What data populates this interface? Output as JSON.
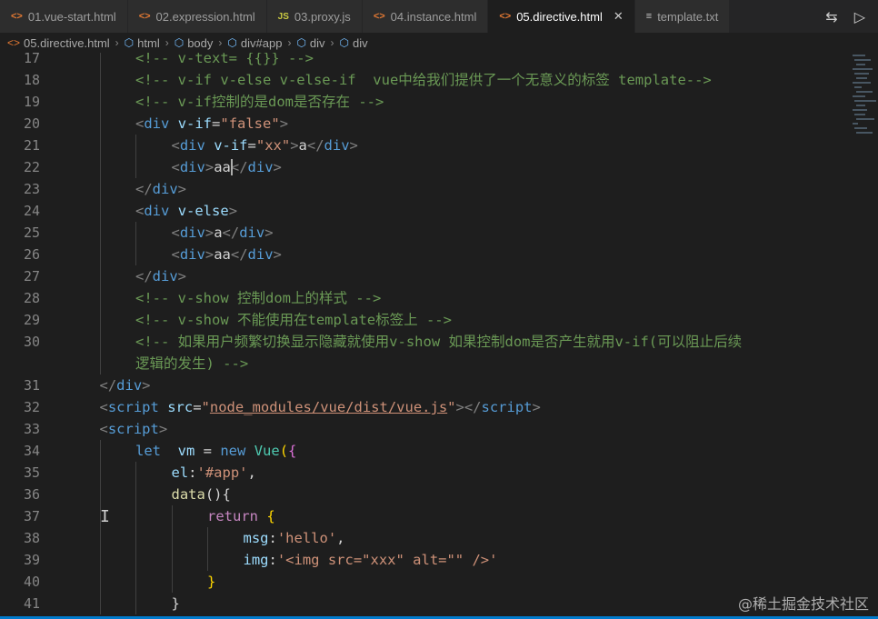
{
  "tabs": [
    {
      "icon": "<>",
      "icon_type": "html",
      "label": "01.vue-start.html",
      "active": false
    },
    {
      "icon": "<>",
      "icon_type": "html",
      "label": "02.expression.html",
      "active": false
    },
    {
      "icon": "JS",
      "icon_type": "js",
      "label": "03.proxy.js",
      "active": false
    },
    {
      "icon": "<>",
      "icon_type": "html",
      "label": "04.instance.html",
      "active": false
    },
    {
      "icon": "<>",
      "icon_type": "html",
      "label": "05.directive.html",
      "active": true
    },
    {
      "icon": "≡",
      "icon_type": "txt",
      "label": "template.txt",
      "active": false
    }
  ],
  "breadcrumb": [
    "05.directive.html",
    "html",
    "body",
    "div#app",
    "div",
    "div"
  ],
  "lines": [
    {
      "n": "17",
      "indent": 2,
      "tokens": [
        [
          "c-com",
          "<!-- v-text= {{}} -->"
        ]
      ],
      "partial": true
    },
    {
      "n": "18",
      "indent": 2,
      "tokens": [
        [
          "c-com",
          "<!-- v-if v-else v-else-if  vue中给我们提供了一个无意义的标签 template-->"
        ]
      ]
    },
    {
      "n": "19",
      "indent": 2,
      "tokens": [
        [
          "c-com",
          "<!-- v-if控制的是dom是否存在 -->"
        ]
      ]
    },
    {
      "n": "20",
      "indent": 2,
      "tokens": [
        [
          "c-punc",
          "<"
        ],
        [
          "c-tag",
          "div"
        ],
        [
          "c-text",
          " "
        ],
        [
          "c-attr",
          "v-if"
        ],
        [
          "c-text",
          "="
        ],
        [
          "c-str",
          "\"false\""
        ],
        [
          "c-punc",
          ">"
        ]
      ]
    },
    {
      "n": "21",
      "indent": 3,
      "tokens": [
        [
          "c-punc",
          "<"
        ],
        [
          "c-tag",
          "div"
        ],
        [
          "c-text",
          " "
        ],
        [
          "c-attr",
          "v-if"
        ],
        [
          "c-text",
          "="
        ],
        [
          "c-str",
          "\"xx\""
        ],
        [
          "c-punc",
          ">"
        ],
        [
          "c-text",
          "a"
        ],
        [
          "c-punc",
          "</"
        ],
        [
          "c-tag",
          "div"
        ],
        [
          "c-punc",
          ">"
        ]
      ]
    },
    {
      "n": "22",
      "indent": 3,
      "tokens": [
        [
          "c-punc",
          "<"
        ],
        [
          "c-tag",
          "div"
        ],
        [
          "c-punc",
          ">"
        ],
        [
          "c-text",
          "aa"
        ],
        [
          "c-punc",
          "</"
        ],
        [
          "c-tag",
          "div"
        ],
        [
          "c-punc",
          ">"
        ]
      ]
    },
    {
      "n": "23",
      "indent": 2,
      "tokens": [
        [
          "c-punc",
          "</"
        ],
        [
          "c-tag",
          "div"
        ],
        [
          "c-punc",
          ">"
        ]
      ]
    },
    {
      "n": "24",
      "indent": 2,
      "tokens": [
        [
          "c-punc",
          "<"
        ],
        [
          "c-tag",
          "div"
        ],
        [
          "c-text",
          " "
        ],
        [
          "c-attr",
          "v-else"
        ],
        [
          "c-punc",
          ">"
        ]
      ]
    },
    {
      "n": "25",
      "indent": 3,
      "tokens": [
        [
          "c-punc",
          "<"
        ],
        [
          "c-tag",
          "div"
        ],
        [
          "c-punc",
          ">"
        ],
        [
          "c-text",
          "a"
        ],
        [
          "c-punc",
          "</"
        ],
        [
          "c-tag",
          "div"
        ],
        [
          "c-punc",
          ">"
        ]
      ]
    },
    {
      "n": "26",
      "indent": 3,
      "tokens": [
        [
          "c-punc",
          "<"
        ],
        [
          "c-tag",
          "div"
        ],
        [
          "c-punc",
          ">"
        ],
        [
          "c-text",
          "aa"
        ],
        [
          "c-punc",
          "</"
        ],
        [
          "c-tag",
          "div"
        ],
        [
          "c-punc",
          ">"
        ]
      ]
    },
    {
      "n": "27",
      "indent": 2,
      "tokens": [
        [
          "c-punc",
          "</"
        ],
        [
          "c-tag",
          "div"
        ],
        [
          "c-punc",
          ">"
        ]
      ]
    },
    {
      "n": "28",
      "indent": 2,
      "tokens": [
        [
          "c-com",
          "<!-- v-show 控制dom上的样式 -->"
        ]
      ]
    },
    {
      "n": "29",
      "indent": 2,
      "tokens": [
        [
          "c-com",
          "<!-- v-show 不能使用在template标签上 -->"
        ]
      ]
    },
    {
      "n": "30",
      "indent": 2,
      "tokens": [
        [
          "c-com",
          "<!-- 如果用户频繁切换显示隐藏就使用v-show 如果控制dom是否产生就用v-if(可以阻止后续"
        ]
      ]
    },
    {
      "n": "",
      "indent": 2,
      "tokens": [
        [
          "c-com",
          "逻辑的发生) -->"
        ]
      ]
    },
    {
      "n": "31",
      "indent": 1,
      "tokens": [
        [
          "c-punc",
          "</"
        ],
        [
          "c-tag",
          "div"
        ],
        [
          "c-punc",
          ">"
        ]
      ]
    },
    {
      "n": "32",
      "indent": 1,
      "tokens": [
        [
          "c-punc",
          "<"
        ],
        [
          "c-tag",
          "script"
        ],
        [
          "c-text",
          " "
        ],
        [
          "c-attr",
          "src"
        ],
        [
          "c-text",
          "="
        ],
        [
          "c-str",
          "\""
        ],
        [
          "c-link",
          "node_modules/vue/dist/vue.js"
        ],
        [
          "c-str",
          "\""
        ],
        [
          "c-punc",
          "></"
        ],
        [
          "c-tag",
          "script"
        ],
        [
          "c-punc",
          ">"
        ]
      ]
    },
    {
      "n": "33",
      "indent": 1,
      "tokens": [
        [
          "c-punc",
          "<"
        ],
        [
          "c-tag",
          "script"
        ],
        [
          "c-punc",
          ">"
        ]
      ]
    },
    {
      "n": "34",
      "indent": 2,
      "tokens": [
        [
          "c-kw",
          "let"
        ],
        [
          "c-text",
          "  "
        ],
        [
          "c-var",
          "vm"
        ],
        [
          "c-text",
          " = "
        ],
        [
          "c-kw",
          "new"
        ],
        [
          "c-text",
          " "
        ],
        [
          "c-cls",
          "Vue"
        ],
        [
          "c-brace",
          "("
        ],
        [
          "c-brace2",
          "{"
        ]
      ]
    },
    {
      "n": "35",
      "indent": 3,
      "tokens": [
        [
          "c-var",
          "el"
        ],
        [
          "c-text",
          ":"
        ],
        [
          "c-str",
          "'#app'"
        ],
        [
          "c-text",
          ","
        ]
      ]
    },
    {
      "n": "36",
      "indent": 3,
      "tokens": [
        [
          "c-fn",
          "data"
        ],
        [
          "c-text",
          "(){"
        ]
      ]
    },
    {
      "n": "37",
      "indent": 4,
      "tokens": [
        [
          "c-ctl",
          "return"
        ],
        [
          "c-text",
          " "
        ],
        [
          "c-brace",
          "{"
        ]
      ]
    },
    {
      "n": "38",
      "indent": 5,
      "tokens": [
        [
          "c-var",
          "msg"
        ],
        [
          "c-text",
          ":"
        ],
        [
          "c-str",
          "'hello'"
        ],
        [
          "c-text",
          ","
        ]
      ]
    },
    {
      "n": "39",
      "indent": 5,
      "tokens": [
        [
          "c-var",
          "img"
        ],
        [
          "c-text",
          ":"
        ],
        [
          "c-str",
          "'<img src=\"xxx\" alt=\"\" />'"
        ]
      ]
    },
    {
      "n": "40",
      "indent": 4,
      "tokens": [
        [
          "c-brace",
          "}"
        ]
      ]
    },
    {
      "n": "41",
      "indent": 3,
      "tokens": [
        [
          "c-text",
          "}"
        ]
      ],
      "partial": true
    }
  ],
  "watermark": "@稀土掘金技术社区"
}
